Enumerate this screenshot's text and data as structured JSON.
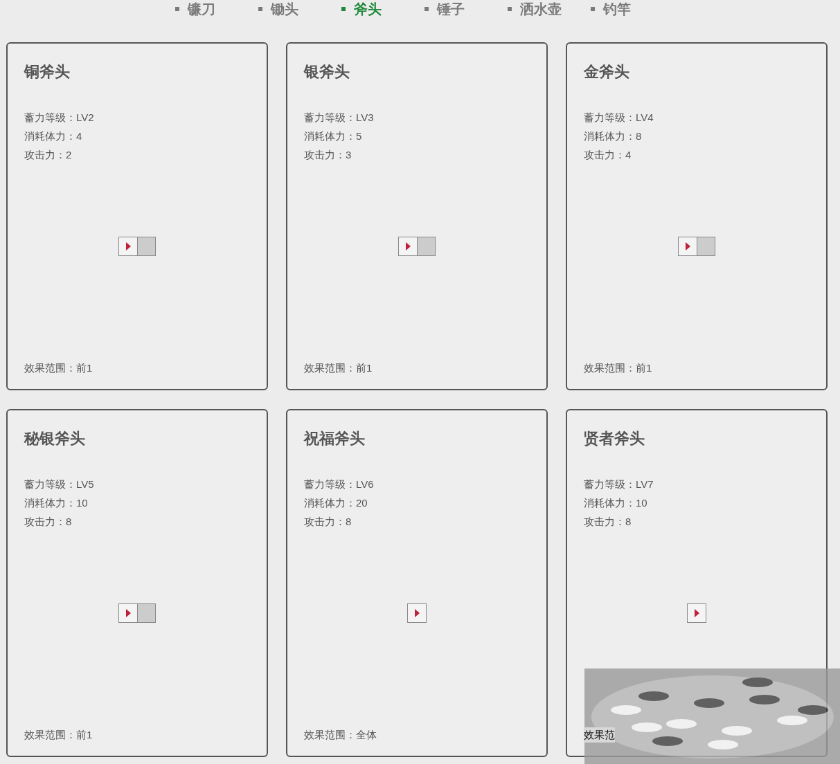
{
  "nav": [
    {
      "label": "镰刀",
      "selected": false
    },
    {
      "label": "锄头",
      "selected": false
    },
    {
      "label": "斧头",
      "selected": true
    },
    {
      "label": "锤子",
      "selected": false
    },
    {
      "label": "洒水壶",
      "selected": false
    },
    {
      "label": "钓竿",
      "selected": false
    }
  ],
  "cards": [
    {
      "title": "铜斧头",
      "stats": [
        "蓄力等级：LV2",
        "消耗体力：4",
        "攻击力：2"
      ],
      "player": {
        "kind": "wide"
      },
      "range": "效果范围：前1",
      "obscured": false
    },
    {
      "title": "银斧头",
      "stats": [
        "蓄力等级：LV3",
        "消耗体力：5",
        "攻击力：3"
      ],
      "player": {
        "kind": "wide"
      },
      "range": "效果范围：前1",
      "obscured": false
    },
    {
      "title": "金斧头",
      "stats": [
        "蓄力等级：LV4",
        "消耗体力：8",
        "攻击力：4"
      ],
      "player": {
        "kind": "wide"
      },
      "range": "效果范围：前1",
      "obscured": false
    },
    {
      "title": "秘银斧头",
      "stats": [
        "蓄力等级：LV5",
        "消耗体力：10",
        "攻击力：8"
      ],
      "player": {
        "kind": "wide"
      },
      "range": "效果范围：前1",
      "obscured": false
    },
    {
      "title": "祝福斧头",
      "stats": [
        "蓄力等级：LV6",
        "消耗体力：20",
        "攻击力：8"
      ],
      "player": {
        "kind": "compact"
      },
      "range": "效果范围：全体",
      "obscured": false
    },
    {
      "title": "贤者斧头",
      "stats": [
        "蓄力等级：LV7",
        "消耗体力：10",
        "攻击力：8"
      ],
      "player": {
        "kind": "compact"
      },
      "range": "效果范",
      "obscured": true
    }
  ]
}
